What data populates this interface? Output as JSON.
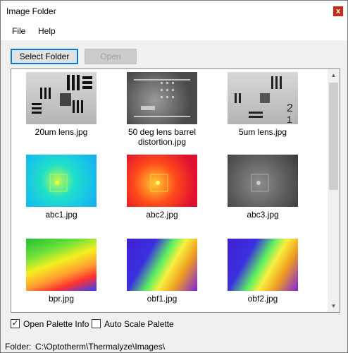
{
  "window": {
    "title": "Image Folder",
    "close_glyph": "x"
  },
  "menu": [
    "File",
    "Help"
  ],
  "buttons": {
    "select_folder": "Select Folder",
    "open": "Open"
  },
  "images": [
    {
      "caption": "20um lens.jpg"
    },
    {
      "caption": "50 deg lens barrel distortion.jpg"
    },
    {
      "caption": "5um lens.jpg"
    },
    {
      "caption": "abc1.jpg"
    },
    {
      "caption": "abc2.jpg"
    },
    {
      "caption": "abc3.jpg"
    },
    {
      "caption": "bpr.jpg"
    },
    {
      "caption": "obf1.jpg"
    },
    {
      "caption": "obf2.jpg"
    }
  ],
  "checkboxes": {
    "open_palette_info": {
      "label": "Open Palette Info",
      "checked": true
    },
    "auto_scale_palette": {
      "label": "Auto Scale Palette",
      "checked": false
    }
  },
  "status": {
    "label": "Folder:",
    "path": "C:\\Optotherm\\Thermalyze\\Images\\"
  }
}
